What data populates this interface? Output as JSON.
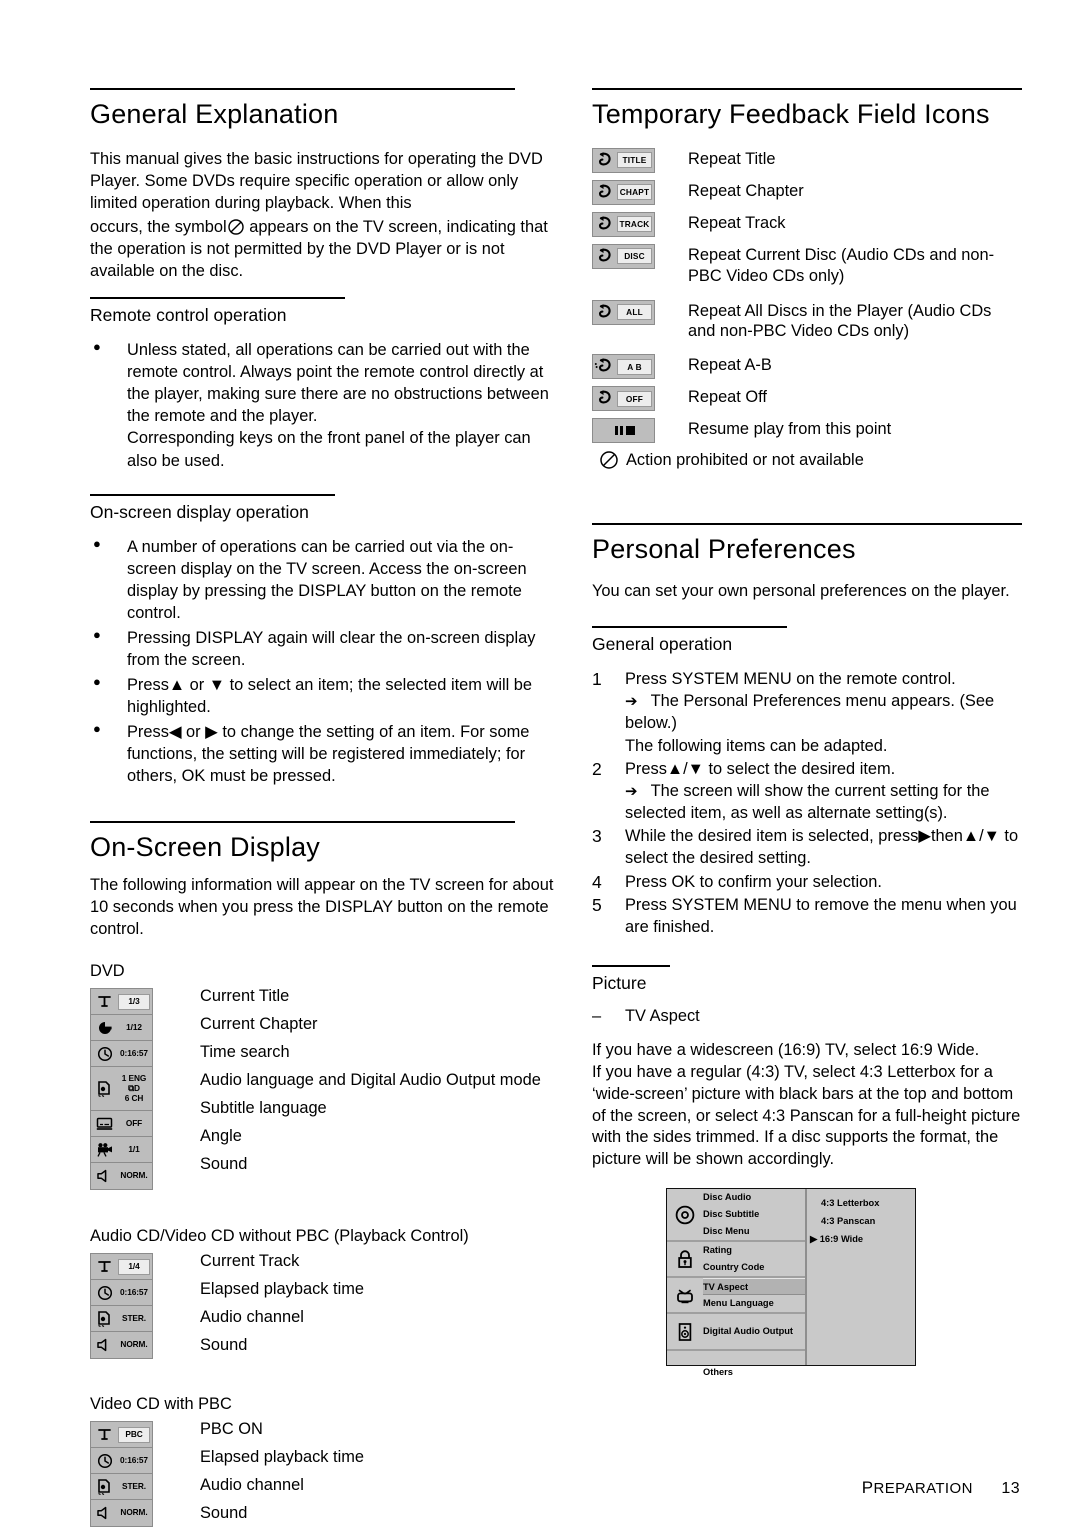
{
  "left": {
    "general_explanation": {
      "title": "General Explanation",
      "para_a": "This manual gives the basic instructions for operating the DVD Player. Some DVDs require specific operation or allow only limited operation during playback. When this",
      "para_b_pre": "occurs, the symbol",
      "para_b_post": "appears on the TV screen, indicating that the operation is not permitted by the DVD Player or is not available on the disc."
    },
    "remote_control": {
      "title": "Remote control operation",
      "bullets": [
        "Unless stated, all operations can be carried out with the remote control. Always point the remote control directly at the player, making sure there are no obstructions between the remote and the player.\nCorresponding keys on the front panel of the player can also be used."
      ]
    },
    "osd_operation": {
      "title": "On-screen display operation",
      "bullets": [
        "A number of operations can be carried out via the on-screen display on the TV screen. Access the on-screen display by pressing the DISPLAY button on the remote control.",
        "Pressing DISPLAY again will clear the on-screen display from the screen.",
        "Press▲ or ▼ to select an item; the selected item will be highlighted.",
        "Press◀ or ▶ to change the setting of an item. For some functions, the setting will be registered immediately; for others, OK must be pressed."
      ]
    },
    "on_screen_display": {
      "title": "On-Screen Display",
      "intro": "The following information will appear on the TV screen for about 10 seconds when you press the DISPLAY button on the remote control.",
      "dvd": {
        "label": "DVD",
        "rows": [
          {
            "glyph": "title-icon",
            "value": "1/3",
            "boxed": true,
            "desc": "Current Title"
          },
          {
            "glyph": "chapter-icon",
            "value": "1/12",
            "boxed": false,
            "desc": "Current Chapter"
          },
          {
            "glyph": "clock-icon",
            "value": "0:16:57",
            "boxed": false,
            "desc": "Time search"
          },
          {
            "glyph": "audio-icon",
            "value": "1 ENG\n⧉D\n6 CH",
            "boxed": false,
            "tall": true,
            "desc": "Audio language and Digital Audio Output mode"
          },
          {
            "glyph": "subtitle-icon",
            "value": "OFF",
            "boxed": false,
            "desc": "Subtitle language"
          },
          {
            "glyph": "angle-icon",
            "value": "1/1",
            "boxed": false,
            "desc": "Angle"
          },
          {
            "glyph": "sound-icon",
            "value": "NORM.",
            "boxed": false,
            "desc": "Sound"
          }
        ]
      },
      "audio_cd": {
        "label": "Audio CD/Video CD without PBC (Playback Control)",
        "rows": [
          {
            "glyph": "title-icon",
            "value": "1/4",
            "boxed": true,
            "desc": "Current Track"
          },
          {
            "glyph": "clock-icon",
            "value": "0:16:57",
            "boxed": false,
            "desc": "Elapsed playback time"
          },
          {
            "glyph": "audio-icon",
            "value": "STER.",
            "boxed": false,
            "desc": "Audio channel"
          },
          {
            "glyph": "sound-icon",
            "value": "NORM.",
            "boxed": false,
            "desc": "Sound"
          }
        ]
      },
      "video_cd_pbc": {
        "label": "Video CD with PBC",
        "rows": [
          {
            "glyph": "title-icon",
            "value": "PBC",
            "boxed": true,
            "desc": "PBC ON"
          },
          {
            "glyph": "clock-icon",
            "value": "0:16:57",
            "boxed": false,
            "desc": "Elapsed playback time"
          },
          {
            "glyph": "audio-icon",
            "value": "STER.",
            "boxed": false,
            "desc": "Audio channel"
          },
          {
            "glyph": "sound-icon",
            "value": "NORM.",
            "boxed": false,
            "desc": "Sound"
          }
        ]
      }
    }
  },
  "right": {
    "feedback": {
      "title": "Temporary Feedback Field Icons",
      "rows": [
        {
          "icon": "repeat-icon",
          "tag": "TITLE",
          "desc": "Repeat Title"
        },
        {
          "icon": "repeat-icon",
          "tag": "CHAPT",
          "desc": "Repeat Chapter"
        },
        {
          "icon": "repeat-icon",
          "tag": "TRACK",
          "desc": "Repeat Track"
        },
        {
          "icon": "repeat-icon",
          "tag": "DISC",
          "desc": "Repeat Current Disc (Audio CDs and non-PBC Video CDs only)"
        },
        {
          "icon": "repeat-icon",
          "tag": "ALL",
          "desc": "Repeat All Discs in the Player (Audio CDs and non-PBC Video CDs only)"
        },
        {
          "icon": "repeat-ab-icon",
          "tag": "A  B",
          "desc": "Repeat A-B"
        },
        {
          "icon": "repeat-icon",
          "tag": "OFF",
          "desc": "Repeat Off"
        }
      ],
      "resume": {
        "icon": "resume-icon",
        "desc": "Resume play from this point"
      },
      "prohibited": {
        "icon": "prohibited-icon",
        "desc": "Action prohibited or not available"
      }
    },
    "personal_preferences": {
      "title": "Personal Preferences",
      "intro": "You can set your own personal preferences on the player.",
      "general_operation": {
        "title": "General operation",
        "steps": [
          {
            "num": "1",
            "text": "Press SYSTEM MENU on the remote control.",
            "arrow": "The Personal Preferences menu appears. (See below.)",
            "after": "The following items can be adapted."
          },
          {
            "num": "2",
            "text": "Press▲/▼ to select the desired item.",
            "arrow": "The screen will show the current setting for the selected item, as well as alternate setting(s)."
          },
          {
            "num": "3",
            "text_pre": "While the desired item is selected, press",
            "text_mid": "then",
            "text_post": "▲/▼ to select the desired setting."
          },
          {
            "num": "4",
            "text": "Press OK to confirm your selection."
          },
          {
            "num": "5",
            "text": "Press SYSTEM MENU to remove the menu when you are finished."
          }
        ]
      },
      "picture": {
        "title": "Picture",
        "dash_item": "TV Aspect",
        "body": "If you have a widescreen (16:9) TV, select 16:9 Wide.\nIf you have a regular (4:3) TV, select 4:3 Letterbox for a ‘wide-screen’ picture with black bars at the top and bottom of the screen, or select 4:3 Panscan for a full-height picture with the sides trimmed. If a disc supports the format, the picture will be shown accordingly."
      },
      "tv_menu": {
        "groups": [
          {
            "icon": "disc-icon",
            "items": [
              {
                "label": "Disc Audio",
                "selected": false
              },
              {
                "label": "Disc Subtitle",
                "selected": false
              },
              {
                "label": "Disc Menu",
                "selected": false
              }
            ]
          },
          {
            "icon": "lock-icon",
            "items": [
              {
                "label": "Rating",
                "selected": false
              },
              {
                "label": "Country Code",
                "selected": false
              }
            ]
          },
          {
            "icon": "tv-icon",
            "items": [
              {
                "label": "TV Aspect",
                "selected": true
              },
              {
                "label": "Menu Language",
                "selected": false
              }
            ]
          },
          {
            "icon": "speaker-icon",
            "items": [
              {
                "label": "Digital Audio Output",
                "selected": false
              }
            ]
          }
        ],
        "last": {
          "label": "Others"
        },
        "options": [
          {
            "label": "4:3 Letterbox",
            "marker": false
          },
          {
            "label": "4:3 Panscan",
            "marker": false
          },
          {
            "label": "16:9 Wide",
            "marker": true
          }
        ]
      }
    }
  },
  "footer": {
    "section_first": "P",
    "section_rest": "REPARATION",
    "page": "13"
  },
  "colors": {
    "icon_bg": "#bdbdbd",
    "icon_border": "#8c8c8c",
    "value_bg": "#ededed",
    "menu_bg": "#c9c9c9",
    "menu_sel": "#b2b2b2"
  }
}
